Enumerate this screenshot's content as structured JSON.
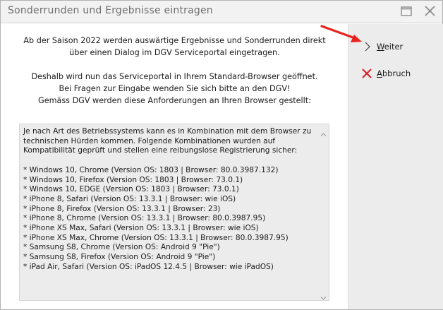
{
  "window": {
    "title": "Sonderrunden und Ergebnisse eintragen"
  },
  "intro": {
    "line1": "Ab der Saison 2022 werden auswärtige Ergebnisse und Sonderrunden direkt",
    "line2": "über einen Dialog im DGV Serviceportal eingetragen.",
    "line3": "Deshalb wird nun das Serviceportal in Ihrem Standard-Browser geöffnet.",
    "line4": "Bei Fragen zur Eingabe wenden Sie sich bitte an den DGV!",
    "line5": "Gemäss DGV werden diese Anforderungen an Ihren Browser gestellt:"
  },
  "requirements": {
    "text": "Je nach Art des Betriebssystems kann es in Kombination mit dem Browser zu technischen Hürden kommen. Folgende Kombinationen wurden auf Kompatibilität geprüft und stellen eine reibungslose Registrierung sicher:\n\n* Windows 10, Chrome (Version OS: 1803 | Browser: 80.0.3987.132)\n* Windows 10, Firefox (Version OS: 1803 | Browser: 73.0.1)\n* Windows 10, EDGE (Version OS: 1803 | Browser: 73.0.1)\n* iPhone 8, Safari (Version OS: 13.3.1 | Browser: wie iOS)\n* iPhone 8, Firefox (Version OS: 13.3.1 | Browser: 23)\n* iPhone 8, Chrome (Version OS: 13.3.1 | Browser: 80.0.3987.95)\n* iPhone XS Max, Safari (Version OS: 13.3.1 | Browser: wie iOS)\n* iPhone XS Max, Chrome (Version OS: 13.3.1 | Browser: 80.0.3987.95)\n* Samsung S8, Chrome (Version OS: Android 9 \"Pie\")\n* Samsung S8, Firefox (Version OS: Android 9 \"Pie\")\n* iPad Air, Safari (Version OS: iPadOS 12.4.5 | Browser: wie iPadOS)"
  },
  "actions": {
    "weiter_label": "Weiter",
    "abbruch_label": "Abbruch"
  },
  "colors": {
    "arrow": "#e8231f",
    "cancel_icon": "#d9252a",
    "panel_bg": "#ececec"
  }
}
